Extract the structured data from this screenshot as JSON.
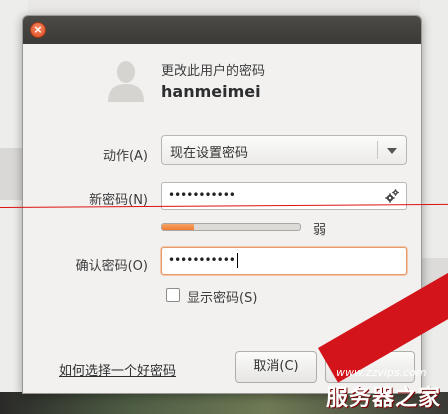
{
  "dialog": {
    "subtitle": "更改此用户的密码",
    "username": "hanmeimei",
    "close_symbol": "×"
  },
  "form": {
    "action_label": "动作(A)",
    "action_value": "现在设置密码",
    "new_password_label": "新密码(N)",
    "new_password_value": "•••••••••••",
    "strength_fraction": 0.23,
    "strength_text": "弱",
    "confirm_label": "确认密码(O)",
    "confirm_value": "•••••••••••",
    "show_password_label": "显示密码(S)",
    "show_password_checked": false
  },
  "footer": {
    "help_link": "如何选择一个好密码",
    "cancel_label": "取消(C)"
  },
  "watermark": {
    "url": "www.zzvips.com",
    "brand": "服务器之家"
  },
  "colors": {
    "accent": "#df4b20",
    "focus_border": "#e79a6c",
    "strength_fill": "#ee7c2f",
    "watermark_red": "#d4141b"
  },
  "icons": {
    "close": "close-icon",
    "avatar": "user-avatar-icon",
    "dropdown": "chevron-down-icon",
    "generate": "gear-icon"
  }
}
